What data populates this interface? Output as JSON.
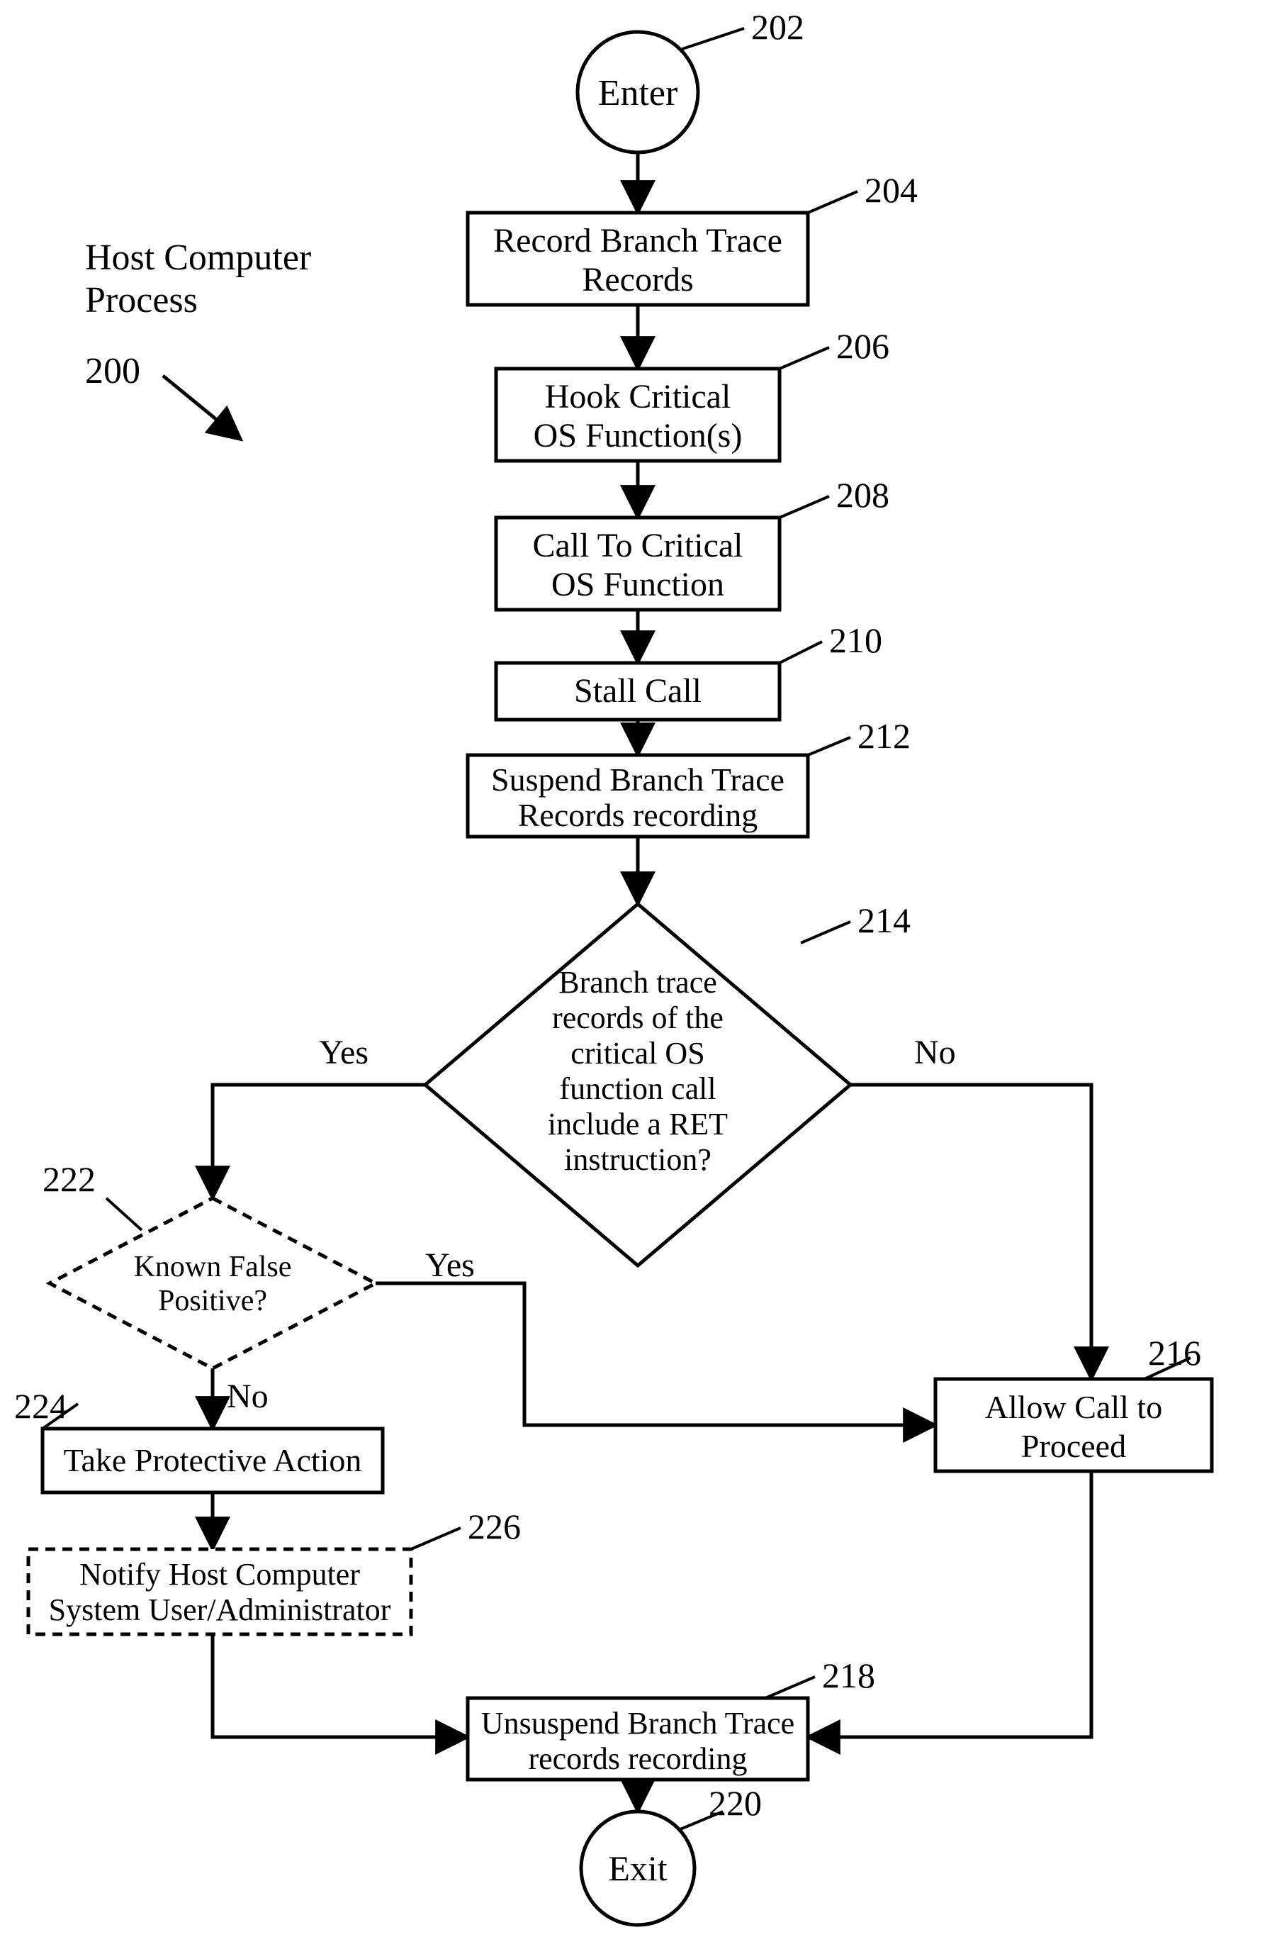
{
  "title": {
    "line1": "Host Computer",
    "line2": "Process",
    "ref": "200"
  },
  "nodes": {
    "enter": {
      "ref": "202",
      "label": "Enter"
    },
    "record": {
      "ref": "204",
      "line1": "Record Branch Trace",
      "line2": "Records"
    },
    "hook": {
      "ref": "206",
      "line1": "Hook Critical",
      "line2": "OS Function(s)"
    },
    "call": {
      "ref": "208",
      "line1": "Call To Critical",
      "line2": "OS Function"
    },
    "stall": {
      "ref": "210",
      "label": "Stall Call"
    },
    "suspend": {
      "ref": "212",
      "line1": "Suspend Branch Trace",
      "line2": "Records recording"
    },
    "decision1": {
      "ref": "214",
      "line1": "Branch trace",
      "line2": "records of the",
      "line3": "critical OS",
      "line4": "function call",
      "line5": "include a RET",
      "line6": "instruction?"
    },
    "decision2": {
      "ref": "222",
      "line1": "Known False",
      "line2": "Positive?"
    },
    "protect": {
      "ref": "224",
      "label": "Take Protective Action"
    },
    "notify": {
      "ref": "226",
      "line1": "Notify Host Computer",
      "line2": "System User/Administrator"
    },
    "allow": {
      "ref": "216",
      "line1": "Allow Call to",
      "line2": "Proceed"
    },
    "unsuspend": {
      "ref": "218",
      "line1": "Unsuspend Branch Trace",
      "line2": "records recording"
    },
    "exit": {
      "ref": "220",
      "label": "Exit"
    }
  },
  "labels": {
    "yes": "Yes",
    "no": "No"
  },
  "chart_data": {
    "type": "flowchart",
    "nodes": [
      {
        "id": "202",
        "kind": "terminal",
        "label": "Enter"
      },
      {
        "id": "204",
        "kind": "process",
        "label": "Record Branch Trace Records"
      },
      {
        "id": "206",
        "kind": "process",
        "label": "Hook Critical OS Function(s)"
      },
      {
        "id": "208",
        "kind": "process",
        "label": "Call To Critical OS Function"
      },
      {
        "id": "210",
        "kind": "process",
        "label": "Stall Call"
      },
      {
        "id": "212",
        "kind": "process",
        "label": "Suspend Branch Trace Records recording"
      },
      {
        "id": "214",
        "kind": "decision",
        "label": "Branch trace records of the critical OS function call include a RET instruction?"
      },
      {
        "id": "222",
        "kind": "decision",
        "label": "Known False Positive?",
        "style": "dashed"
      },
      {
        "id": "224",
        "kind": "process",
        "label": "Take Protective Action"
      },
      {
        "id": "226",
        "kind": "process",
        "label": "Notify Host Computer System User/Administrator",
        "style": "dashed"
      },
      {
        "id": "216",
        "kind": "process",
        "label": "Allow Call to Proceed"
      },
      {
        "id": "218",
        "kind": "process",
        "label": "Unsuspend Branch Trace records recording"
      },
      {
        "id": "220",
        "kind": "terminal",
        "label": "Exit"
      }
    ],
    "edges": [
      {
        "from": "202",
        "to": "204"
      },
      {
        "from": "204",
        "to": "206"
      },
      {
        "from": "206",
        "to": "208"
      },
      {
        "from": "208",
        "to": "210"
      },
      {
        "from": "210",
        "to": "212"
      },
      {
        "from": "212",
        "to": "214"
      },
      {
        "from": "214",
        "to": "222",
        "label": "Yes"
      },
      {
        "from": "214",
        "to": "216",
        "label": "No"
      },
      {
        "from": "222",
        "to": "216",
        "label": "Yes"
      },
      {
        "from": "222",
        "to": "224",
        "label": "No"
      },
      {
        "from": "224",
        "to": "226"
      },
      {
        "from": "226",
        "to": "218"
      },
      {
        "from": "216",
        "to": "218"
      },
      {
        "from": "218",
        "to": "220"
      }
    ],
    "title": "Host Computer Process (200)"
  }
}
